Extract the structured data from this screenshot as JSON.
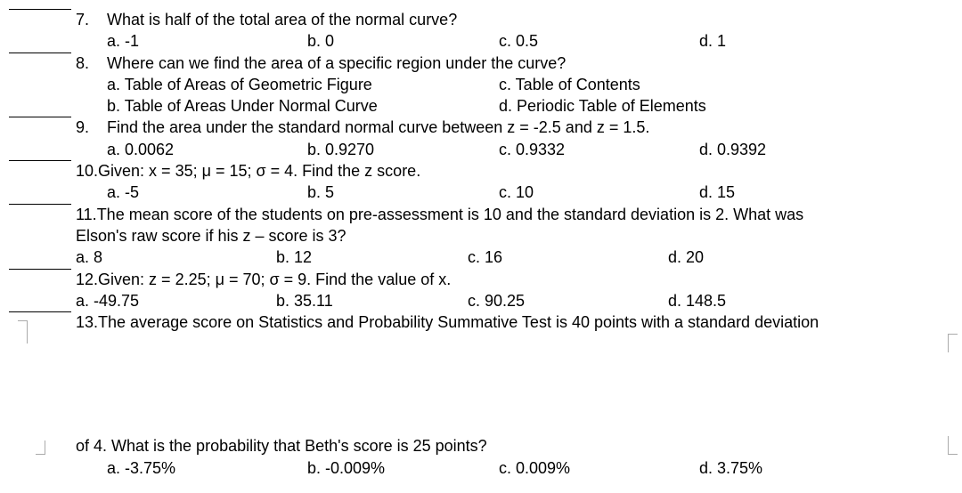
{
  "q7": {
    "num": "7.",
    "text": "What is half of the total area of the normal curve?",
    "a": "a.   -1",
    "b": "b. 0",
    "c": "c. 0.5",
    "d": "d. 1"
  },
  "q8": {
    "num": "8.",
    "text": "Where can we find the area of a specific region under the curve?",
    "a": "a.   Table of Areas of Geometric Figure",
    "b": "b.   Table of Areas Under Normal Curve",
    "c": "c. Table of Contents",
    "d": "d. Periodic Table of Elements"
  },
  "q9": {
    "num": "9.",
    "text": "Find the area under the standard normal curve between z = -2.5 and z = 1.5.",
    "a": "a. 0.0062",
    "b": "b. 0.9270",
    "c": "c.  0.9332",
    "d": "d. 0.9392"
  },
  "q10": {
    "num": "10.",
    "text": "Given: x = 35; μ = 15; σ = 4. Find the z score.",
    "a": "a. -5",
    "b": "b. 5",
    "c": "c. 10",
    "d": "d. 15"
  },
  "q11": {
    "num": "11.",
    "text": "The mean score of the students on pre-assessment is 10 and the standard deviation is 2. What was",
    "text2": "Elson's raw score if his z – score is 3?",
    "a": "a. 8",
    "b": "b. 12",
    "c": "c. 16",
    "d": "d. 20"
  },
  "q12": {
    "num": "12.",
    "text": "Given: z = 2.25; μ = 70; σ  = 9. Find the value of x.",
    "a": "a. -49.75",
    "b": "b. 35.11",
    "c": "c. 90.25",
    "d": "d. 148.5"
  },
  "q13": {
    "num": "13.",
    "text": "The average score on Statistics and Probability Summative Test is 40 points with a standard deviation",
    "text2": "of 4. What is the probability that Beth's score is 25 points?",
    "a": "a. -3.75%",
    "b": "b. -0.009%",
    "c": "c. 0.009%",
    "d": "d. 3.75%"
  }
}
